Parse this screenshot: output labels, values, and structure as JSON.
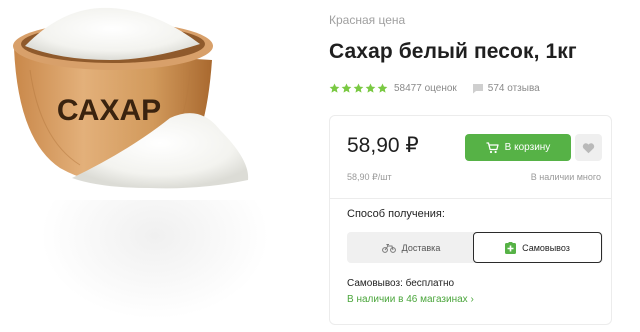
{
  "product": {
    "brand": "Красная цена",
    "title": "Сахар белый песок, 1кг",
    "image_text": "САХАР",
    "rating": {
      "stars": 5,
      "count_text": "58477 оценок"
    },
    "reviews_text": "574 отзыва"
  },
  "purchase": {
    "price": "58,90 ₽",
    "add_to_cart_label": "В корзину",
    "unit_price": "58,90 ₽/шт",
    "availability": "В наличии много"
  },
  "delivery": {
    "label": "Способ получения:",
    "options": [
      "Доставка",
      "Самовывоз"
    ],
    "selected": "Самовывоз",
    "pickup_cost": "Самовывоз: бесплатно",
    "stores_link": "В наличии в 46 магазинах ›"
  },
  "colors": {
    "accent_green": "#56b246",
    "link_green": "#4ba63c",
    "star": "#7ac943",
    "muted_text": "#9a9a9a"
  },
  "icons": [
    "star-icon",
    "reviews-icon",
    "cart-icon",
    "heart-icon",
    "bicycle-icon",
    "pharmacy-cross-icon"
  ]
}
